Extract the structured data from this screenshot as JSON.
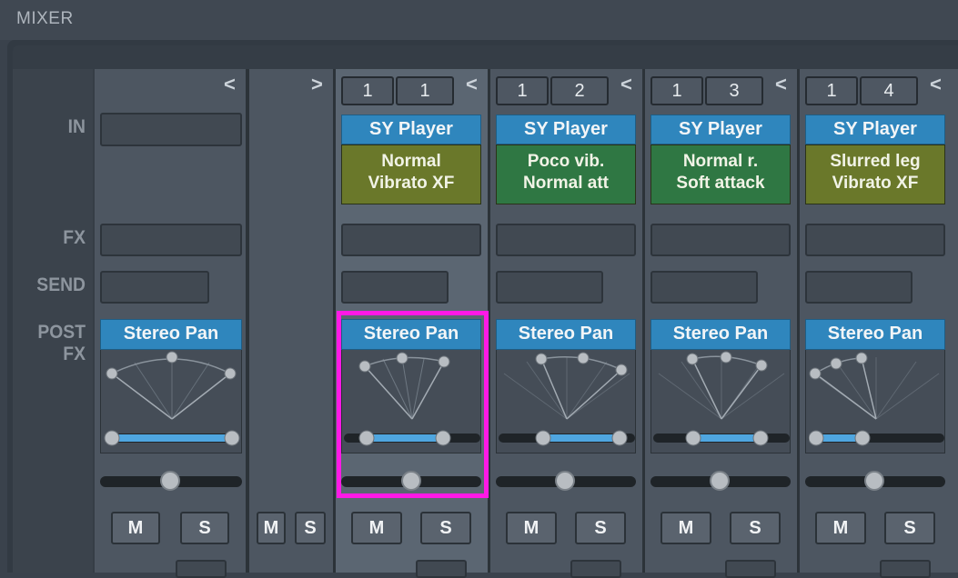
{
  "window": {
    "title": "MIXER"
  },
  "row_labels": {
    "in": "IN",
    "fx": "FX",
    "send": "SEND",
    "post_fx": "POST FX"
  },
  "master": {
    "collapse": "<",
    "plugin": "Stereo Pan",
    "mute": "M",
    "solo": "S"
  },
  "aux": {
    "expand": ">",
    "mute": "M",
    "solo": "S"
  },
  "channels": [
    {
      "collapse": "<",
      "port": "1",
      "channel": "1",
      "instrument": "SY Player",
      "preset_line1": "Normal",
      "preset_line2": "Vibrato XF",
      "preset_color": "#6a782a",
      "plugin": "Stereo Pan",
      "mute": "M",
      "solo": "S"
    },
    {
      "collapse": "<",
      "port": "1",
      "channel": "2",
      "instrument": "SY Player",
      "preset_line1": "Poco vib.",
      "preset_line2": "Normal att",
      "preset_color": "#2f7743",
      "plugin": "Stereo Pan",
      "mute": "M",
      "solo": "S"
    },
    {
      "collapse": "<",
      "port": "1",
      "channel": "3",
      "instrument": "SY Player",
      "preset_line1": "Normal r.",
      "preset_line2": "Soft attack",
      "preset_color": "#2f7743",
      "plugin": "Stereo Pan",
      "mute": "M",
      "solo": "S"
    },
    {
      "collapse": "<",
      "port": "1",
      "channel": "4",
      "instrument": "SY Player",
      "preset_line1": "Slurred leg",
      "preset_line2": "Vibrato XF",
      "preset_color": "#6a782a",
      "plugin": "Stereo Pan",
      "mute": "M",
      "solo": "S"
    }
  ],
  "colors": {
    "accent_blue": "#2f86bd",
    "highlight": "#ff19e6",
    "range_bar": "#4fa6e0"
  }
}
